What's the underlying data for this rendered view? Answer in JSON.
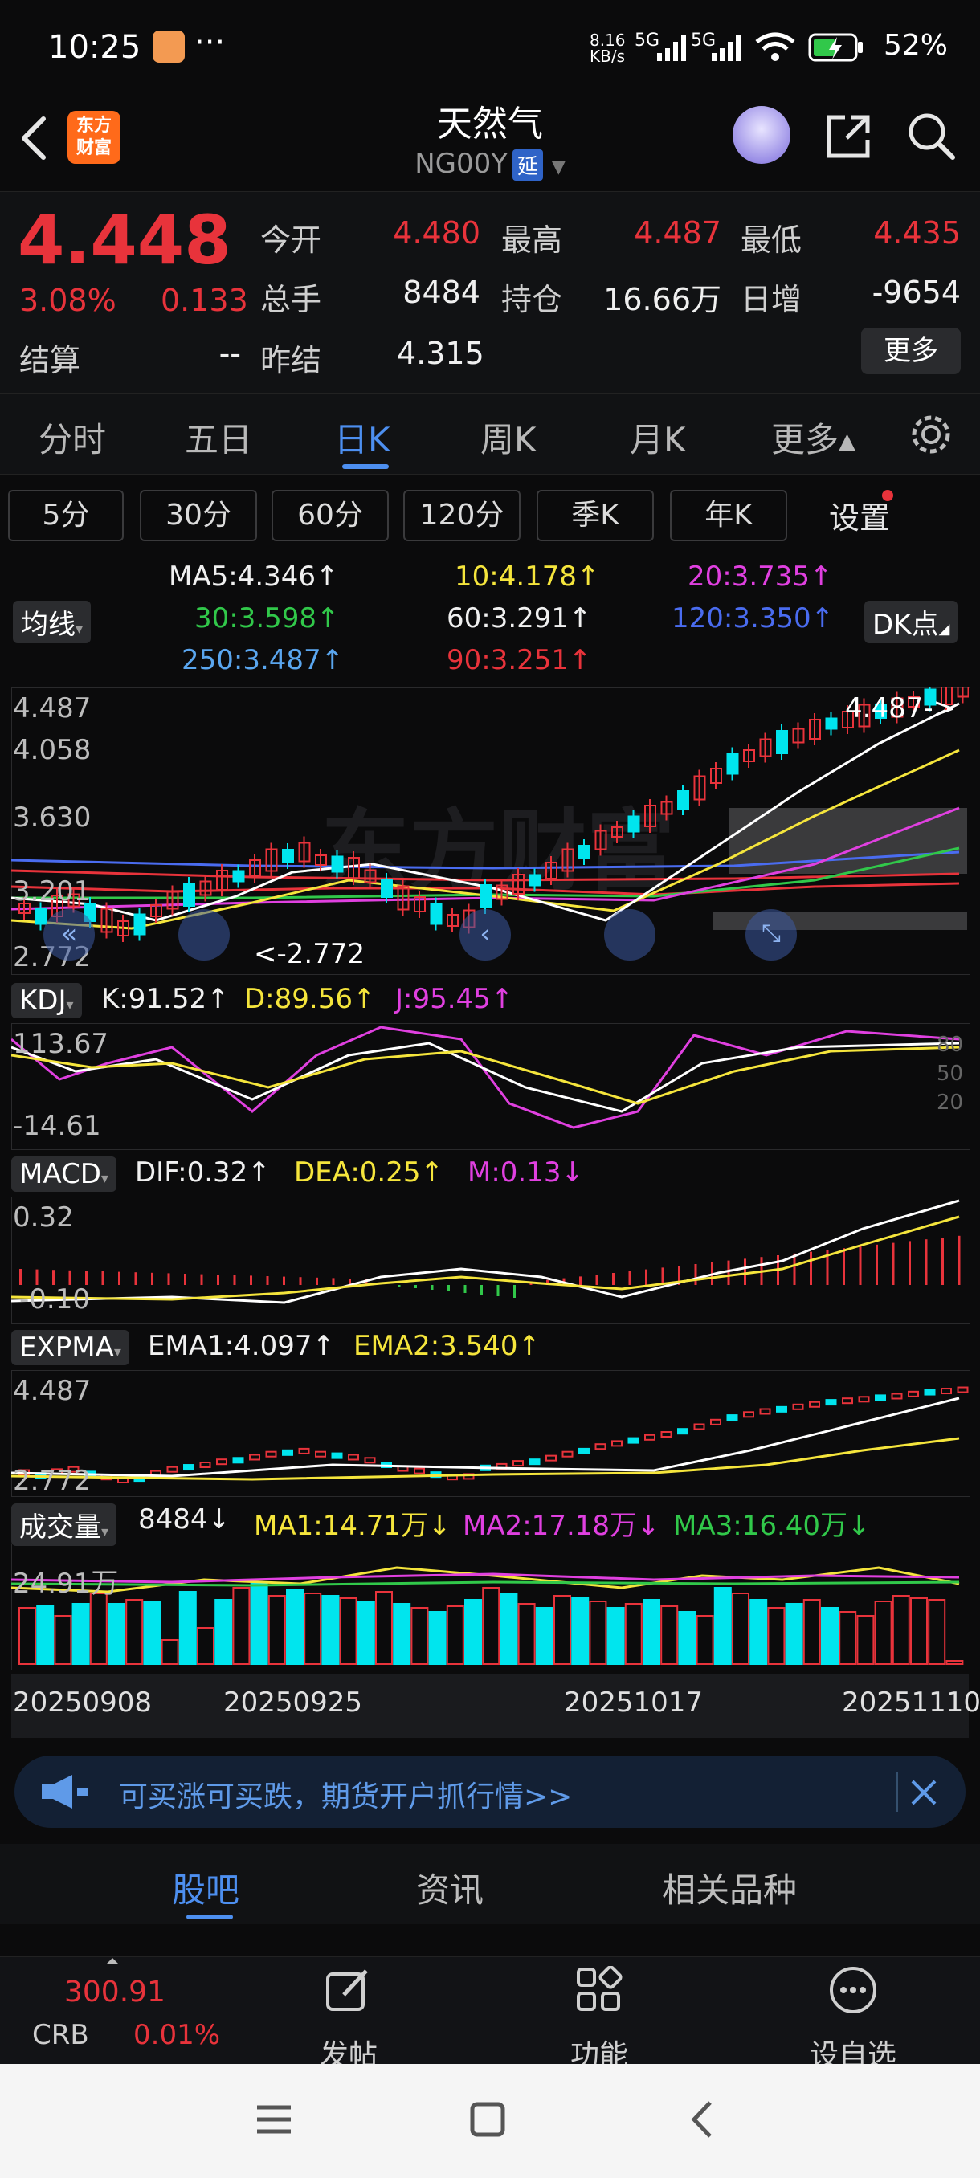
{
  "status": {
    "time": "10:25",
    "dots": "···",
    "net_speed": "8.16 KB/s",
    "signal1": "5G",
    "signal2": "5G",
    "battery": "52%"
  },
  "nav": {
    "title": "天然气",
    "code": "NG00Y",
    "delay_badge": "延",
    "logo_line1": "东方",
    "logo_line2": "财富"
  },
  "quote": {
    "price": "4.448",
    "change_pct": "3.08%",
    "change": "0.133",
    "open_label": "今开",
    "open": "4.480",
    "high_label": "最高",
    "high": "4.487",
    "low_label": "最低",
    "low": "4.435",
    "volume_label": "总手",
    "volume": "8484",
    "oi_label": "持仓",
    "oi": "16.66万",
    "daily_inc_label": "日增",
    "daily_inc": "-9654",
    "settle_label": "结算",
    "settle": "--",
    "prev_settle_label": "昨结",
    "prev_settle": "4.315",
    "more": "更多"
  },
  "period_tabs": [
    "分时",
    "五日",
    "日K",
    "周K",
    "月K",
    "更多▴"
  ],
  "sub_periods": [
    "5分",
    "30分",
    "60分",
    "120分",
    "季K",
    "年K"
  ],
  "settings_label": "设置",
  "ma": {
    "pill": "均线",
    "dk_pill": "DK点",
    "ma5": "MA5:4.346↑",
    "ma10": "10:4.178↑",
    "ma20": "20:3.735↑",
    "ma30": "30:3.598↑",
    "ma60": "60:3.291↑",
    "ma120": "120:3.350↑",
    "ma250": "250:3.487↑",
    "ma90": "90:3.251↑"
  },
  "main_axis": {
    "y1": "4.487",
    "y2": "4.058",
    "y3": "3.630",
    "y4": "3.201",
    "y5": "2.772",
    "hi_marker": "4.487->",
    "lo_marker": "<-2.772"
  },
  "kdj": {
    "pill": "KDJ",
    "k": "K:91.52↑",
    "d": "D:89.56↑",
    "j": "J:95.45↑",
    "top": "113.67",
    "bottom": "-14.61",
    "r80": "80",
    "r50": "50",
    "r20": "20"
  },
  "macd": {
    "pill": "MACD",
    "dif": "DIF:0.32↑",
    "dea": "DEA:0.25↑",
    "m": "M:0.13↓",
    "top": "0.32",
    "bottom": "-0.10"
  },
  "expma": {
    "pill": "EXPMA",
    "ema1": "EMA1:4.097↑",
    "ema2": "EMA2:3.540↑",
    "top": "4.487",
    "bottom": "2.772"
  },
  "vol": {
    "pill": "成交量",
    "v": "8484↓",
    "ma1": "MA1:14.71万↓",
    "ma2": "MA2:17.18万↓",
    "ma3": "MA3:16.40万↓",
    "top": "24.91万"
  },
  "dates": [
    "20250908",
    "20250925",
    "20251017",
    "20251110"
  ],
  "banner": {
    "text": "可买涨可买跌，期货开户抓行情>>"
  },
  "bottom_tabs": [
    "股吧",
    "资讯",
    "相关品种"
  ],
  "toolbar": {
    "crb_value": "300.91",
    "crb_label": "CRB",
    "crb_change": "0.01%",
    "post": "发帖",
    "func": "功能",
    "watch": "设自选"
  },
  "colors": {
    "up": "#e8333b",
    "down": "#00e5ee",
    "accent": "#4d8ff0"
  }
}
